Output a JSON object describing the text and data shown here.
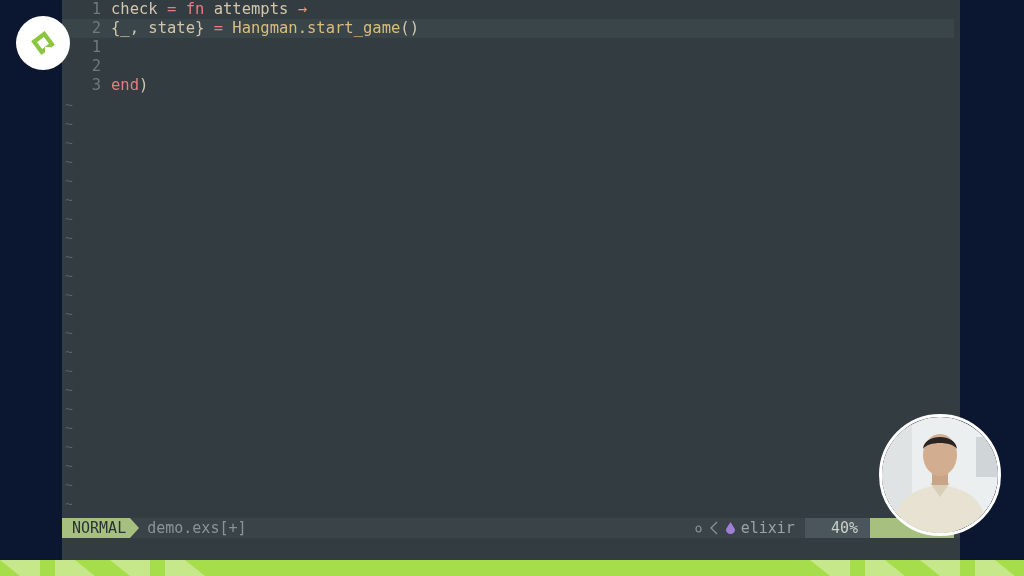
{
  "editor": {
    "lines": [
      {
        "number": "1",
        "current": false,
        "tokens": [
          {
            "kind": "ident",
            "text": "check"
          },
          {
            "kind": "op",
            "text": " = "
          },
          {
            "kind": "keyword",
            "text": "fn"
          },
          {
            "kind": "ident",
            "text": " attempts "
          },
          {
            "kind": "arrow",
            "text": "→"
          }
        ]
      },
      {
        "number": "2",
        "current": true,
        "tokens": [
          {
            "kind": "ident",
            "text": "{_, state}"
          },
          {
            "kind": "op",
            "text": " = "
          },
          {
            "kind": "module",
            "text": "Hangman.start_game"
          },
          {
            "kind": "ident",
            "text": "()"
          }
        ]
      },
      {
        "number": "1",
        "current": false
      },
      {
        "number": "2",
        "current": false
      },
      {
        "number": "3",
        "current": false,
        "tokens": [
          {
            "kind": "keyword",
            "text": "end"
          },
          {
            "kind": "ident",
            "text": ")"
          }
        ]
      }
    ],
    "filler_lines": [
      "~",
      "~",
      "~",
      "~",
      "~",
      "~",
      "~",
      "~",
      "~",
      "~",
      "~",
      "~",
      "~",
      "~",
      "~",
      "~",
      "~",
      "~",
      "~",
      "~",
      "~",
      "~"
    ]
  },
  "status_bar": {
    "mode": "NORMAL",
    "file": "demo.exs[+]",
    "filetype": "elixir",
    "progress": "40%"
  }
}
